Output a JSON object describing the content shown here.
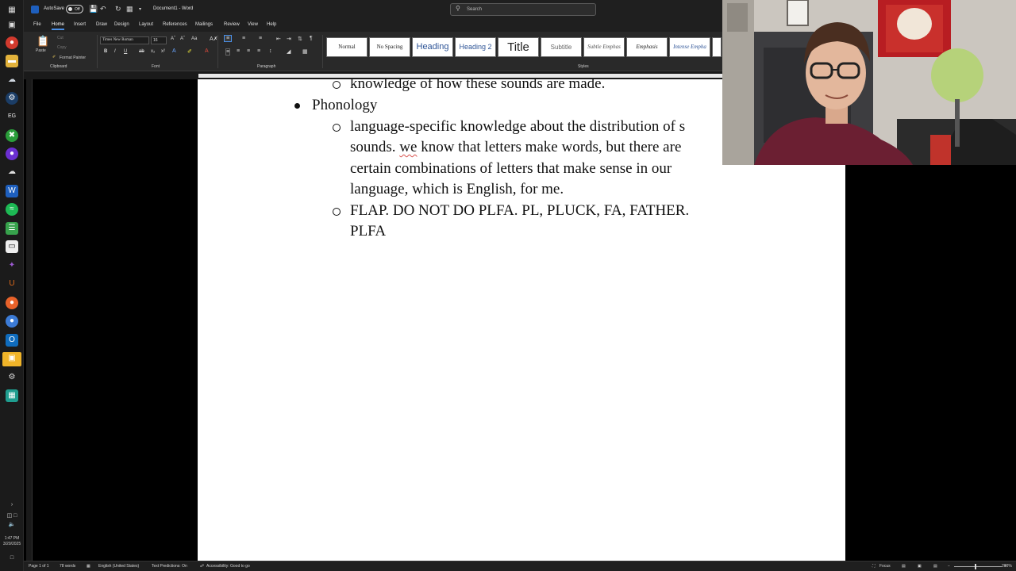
{
  "taskbar": {
    "icons": [
      "windows-start-icon",
      "task-view-icon",
      "chrome-icon",
      "folder-icon",
      "edge-icon",
      "steam-icon",
      "epic-games-icon",
      "xbox-icon",
      "obs-icon",
      "file-explorer-icon",
      "word-icon",
      "spotify-icon",
      "notepad-icon",
      "terminal-icon",
      "app-icon",
      "ubisoft-icon",
      "firefox-icon",
      "chromium-icon",
      "outlook-icon",
      "sticky-notes-icon",
      "settings-icon",
      "calculator-icon"
    ],
    "clock_time": "1:47 PM",
    "clock_date": "3/29/2025"
  },
  "titlebar": {
    "autosave_label": "AutoSave",
    "autosave_state": "Off",
    "document_title": "Document1 - Word",
    "search_placeholder": "Search"
  },
  "menu": {
    "tabs": [
      "File",
      "Home",
      "Insert",
      "Draw",
      "Design",
      "Layout",
      "References",
      "Mailings",
      "Review",
      "View",
      "Help"
    ],
    "active_tab": "Home"
  },
  "ribbon": {
    "clipboard": {
      "paste": "Paste",
      "cut": "Cut",
      "copy": "Copy",
      "format_painter": "Format Painter",
      "label": "Clipboard"
    },
    "font": {
      "name": "Times New Roman",
      "size": "16",
      "label": "Font"
    },
    "paragraph": {
      "label": "Paragraph"
    },
    "styles": {
      "label": "Styles",
      "items": [
        "Normal",
        "No Spacing",
        "Heading",
        "Heading 2",
        "Title",
        "Subtitle",
        "Subtle Emphas",
        "Emphasis",
        "Intense Empha"
      ]
    }
  },
  "document": {
    "line_partial": "knowledge of how these sounds are made.",
    "bullet_phonology": "Phonology",
    "sub1_line1": "language-specific knowledge about the distribution of s",
    "sub1_line2_pre": "sounds. ",
    "sub1_line2_err": "we",
    "sub1_line2_post": " know that letters make words, but there are",
    "sub1_line3": "certain combinations of letters that make sense in our",
    "sub1_line4": "language, which is English, for me.",
    "sub2_line1": "FLAP. DO NOT DO PLFA. PL, PLUCK, FA, FATHER.",
    "sub2_line2": "PLFA"
  },
  "statusbar": {
    "page": "Page 1 of 1",
    "words": "78 words",
    "language": "English (United States)",
    "text_predictions": "Text Predictions: On",
    "accessibility": "Accessibility: Good to go",
    "focus": "Focus",
    "zoom": "200%"
  },
  "colors": {
    "accent": "#4a8fe7",
    "word_blue": "#1e5fbd",
    "spell_error": "#d9534f"
  }
}
